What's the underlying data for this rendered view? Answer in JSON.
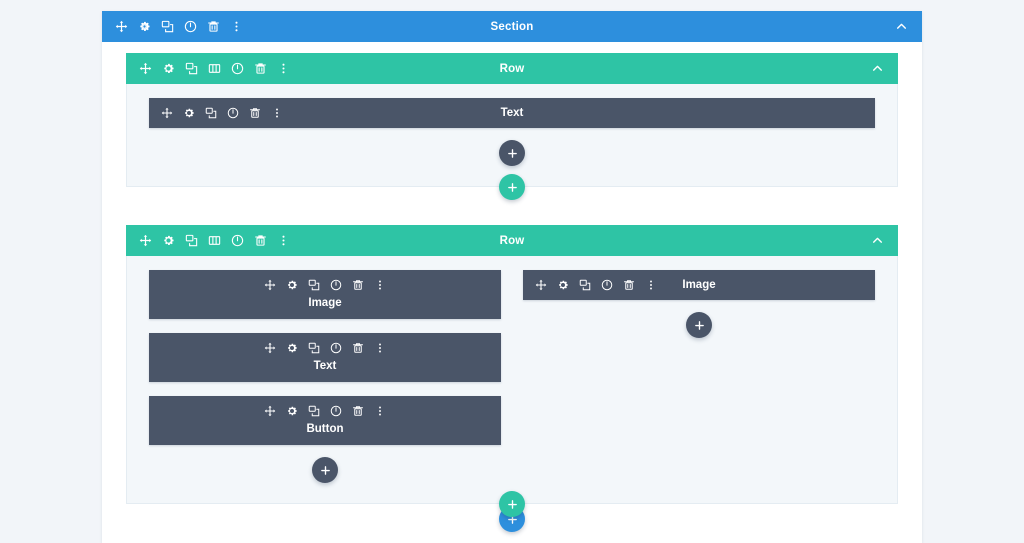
{
  "builder": {
    "canvas_background": "#f2f5f9",
    "section": {
      "label": "Section",
      "color": "#2d8fdd",
      "collapse_icon": "chevron-up-icon",
      "toolbar": [
        {
          "name": "move-icon",
          "title": "Move Section"
        },
        {
          "name": "gear-icon",
          "title": "Section Settings"
        },
        {
          "name": "duplicate-icon",
          "title": "Duplicate Section"
        },
        {
          "name": "power-icon",
          "title": "Disable Section"
        },
        {
          "name": "trash-icon",
          "title": "Delete Section"
        },
        {
          "name": "more-vertical-icon",
          "title": "More Options"
        }
      ]
    },
    "row_color": "#2ec4a5",
    "module_color": "#4a5568",
    "row_toolbar": [
      {
        "name": "move-icon",
        "title": "Move Row"
      },
      {
        "name": "gear-icon",
        "title": "Row Settings"
      },
      {
        "name": "duplicate-icon",
        "title": "Duplicate Row"
      },
      {
        "name": "columns-icon",
        "title": "Change Column Structure"
      },
      {
        "name": "power-icon",
        "title": "Disable Row"
      },
      {
        "name": "trash-icon",
        "title": "Delete Row"
      },
      {
        "name": "more-vertical-icon",
        "title": "More Options"
      }
    ],
    "module_toolbar": [
      {
        "name": "move-icon",
        "title": "Move Module"
      },
      {
        "name": "gear-icon",
        "title": "Module Settings"
      },
      {
        "name": "duplicate-icon",
        "title": "Duplicate Module"
      },
      {
        "name": "power-icon",
        "title": "Disable Module"
      },
      {
        "name": "trash-icon",
        "title": "Delete Module"
      },
      {
        "name": "more-vertical-icon",
        "title": "More Options"
      }
    ],
    "rows": [
      {
        "label": "Row",
        "collapse_icon": "chevron-up-icon",
        "columns": [
          {
            "layout": "inline",
            "modules": [
              {
                "label": "Text"
              }
            ],
            "add_module_label": "+"
          }
        ]
      },
      {
        "label": "Row",
        "collapse_icon": "chevron-up-icon",
        "columns": [
          {
            "layout": "stacked",
            "modules": [
              {
                "label": "Image"
              },
              {
                "label": "Text"
              },
              {
                "label": "Button"
              }
            ],
            "add_module_label": "+"
          },
          {
            "layout": "inline",
            "modules": [
              {
                "label": "Image"
              }
            ],
            "add_module_label": "+"
          }
        ]
      }
    ],
    "add_buttons": {
      "add_module_label": "+",
      "add_row_label": "+",
      "add_section_label": "+"
    }
  }
}
